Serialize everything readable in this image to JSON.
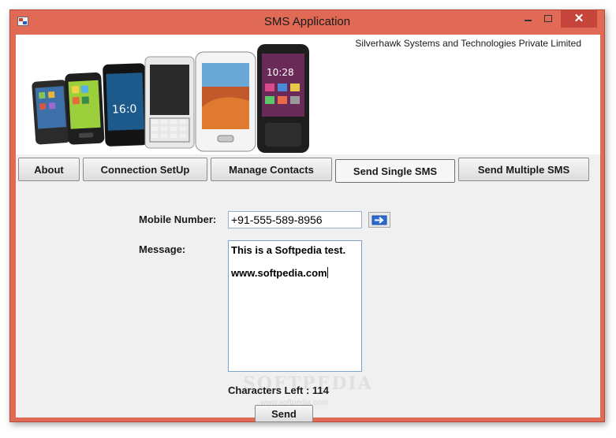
{
  "window": {
    "title": "SMS Application",
    "close_glyph": "✕"
  },
  "banner": {
    "company": "Silverhawk Systems and Technologies Private Limited",
    "phone_screens": {
      "clock_a": "16:0",
      "clock_b": "10:28"
    }
  },
  "tabs": [
    {
      "label": "About"
    },
    {
      "label": "Connection SetUp"
    },
    {
      "label": "Manage Contacts"
    },
    {
      "label": "Send Single SMS",
      "active": true
    },
    {
      "label": "Send Multiple SMS"
    }
  ],
  "form": {
    "mobile_label": "Mobile Number:",
    "mobile_value": "+91-555-589-8956",
    "message_label": "Message:",
    "message_line1": "This is a Softpedia test.",
    "message_line2": "www.softpedia.com",
    "chars_left": "Characters Left : 114",
    "send_label": "Send",
    "arrow_icon": "arrow-right-icon"
  },
  "watermark": {
    "text": "SOFTPEDIA",
    "url": "www.softpedia.com"
  },
  "colors": {
    "frame": "#e06a56",
    "close": "#c7443a",
    "arrow": "#2a6bd0"
  }
}
